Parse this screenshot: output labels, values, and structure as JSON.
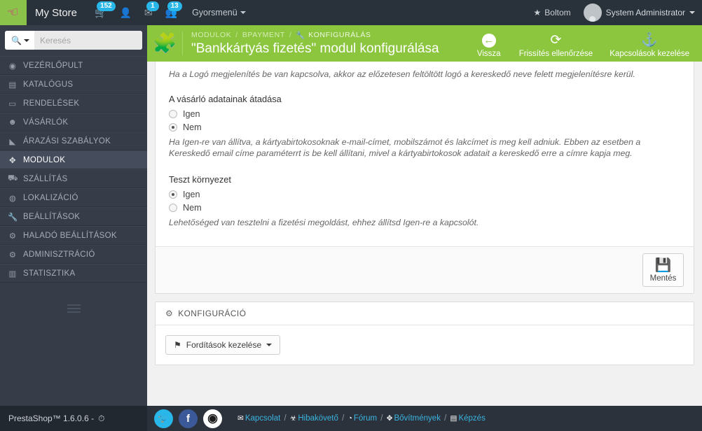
{
  "header": {
    "cursor_icon": "hand-pointer-icon",
    "store_name": "My Store",
    "cart_icon": "cart-icon",
    "cart_badge": "152",
    "customer_icon": "person-icon",
    "mail_icon": "envelope-icon",
    "mail_badge": "1",
    "people_icon": "customers-icon",
    "people_badge": "13",
    "quickmenu_label": "Gyorsmenü",
    "shop_icon": "star-icon",
    "shop_label": "Boltom",
    "avatar_icon": "avatar",
    "user_name": "System Administrator"
  },
  "sidebar": {
    "search_icon": "search-icon",
    "search_placeholder": "Keresés",
    "search_value": "",
    "collapse_icon": "collapse-handle-icon",
    "items": [
      {
        "label": "VEZÉRLŐPULT",
        "icon": "dashboard-icon",
        "glyph": "◉",
        "active": false
      },
      {
        "label": "KATALÓGUS",
        "icon": "catalog-icon",
        "glyph": "▤",
        "active": false
      },
      {
        "label": "RENDELÉSEK",
        "icon": "orders-icon",
        "glyph": "▭",
        "active": false
      },
      {
        "label": "VÁSÁRLÓK",
        "icon": "customers-icon",
        "glyph": "☻",
        "active": false
      },
      {
        "label": "ÁRAZÁSI SZABÁLYOK",
        "icon": "price-rules-icon",
        "glyph": "◣",
        "active": false
      },
      {
        "label": "MODULOK",
        "icon": "modules-icon",
        "glyph": "✥",
        "active": true
      },
      {
        "label": "SZÁLLÍTÁS",
        "icon": "shipping-icon",
        "glyph": "⛟",
        "active": false
      },
      {
        "label": "LOKALIZÁCIÓ",
        "icon": "globe-icon",
        "glyph": "◍",
        "active": false
      },
      {
        "label": "BEÁLLÍTÁSOK",
        "icon": "wrench-icon",
        "glyph": "🔧",
        "active": false
      },
      {
        "label": "HALADÓ BEÁLLÍTÁSOK",
        "icon": "gears-icon",
        "glyph": "⚙",
        "active": false
      },
      {
        "label": "ADMINISZTRÁCIÓ",
        "icon": "gear-icon",
        "glyph": "⚙",
        "active": false
      },
      {
        "label": "STATISZTIKA",
        "icon": "chart-icon",
        "glyph": "▥",
        "active": false
      }
    ],
    "version_icon": "clock-icon",
    "version_label": "PrestaShop™ 1.6.0.6 -"
  },
  "page_head": {
    "module_icon": "puzzle-icon",
    "breadcrumb": {
      "level1": "MODULOK",
      "level2": "BPAYMENT",
      "current_icon": "wrench-icon",
      "current": "KONFIGURÁLÁS",
      "separator": "/"
    },
    "title": "\"Bankkártyás fizetés\" modul konfigurálása",
    "tools": [
      {
        "label": "Vissza",
        "icon": "back-arrow-icon",
        "glyph": "◉"
      },
      {
        "label": "Frissítés ellenőrzése",
        "icon": "refresh-icon",
        "glyph": "⟳"
      },
      {
        "label": "Kapcsolások kezelése",
        "icon": "anchor-icon",
        "glyph": "⚓"
      }
    ]
  },
  "form": {
    "logo_help": "Ha a Logó megjelenítés be van kapcsolva, akkor az előzetesen feltöltött logó a kereskedő neve felett megjelenítésre kerül.",
    "customer_data": {
      "label": "A vásárló adatainak átadása",
      "options": [
        {
          "label": "Igen",
          "checked": false
        },
        {
          "label": "Nem",
          "checked": true
        }
      ],
      "help": "Ha Igen-re van állítva, a kártyabirtokosoknak e-mail-címet, mobilszámot és lakcímet is meg kell adniuk. Ebben az esetben a Kereskedő email címe paraméterrt is be kell állítani, mivel a kártyabirtokosok adatait a kereskedő erre a címre kapja meg."
    },
    "test_env": {
      "label": "Teszt környezet",
      "options": [
        {
          "label": "Igen",
          "checked": true
        },
        {
          "label": "Nem",
          "checked": false
        }
      ],
      "help": "Lehetőséged van tesztelni a fizetési megoldást, ehhez állítsd Igen-re a kapcsolót."
    },
    "save": {
      "label": "Mentés",
      "icon": "floppy-save-icon"
    }
  },
  "config_panel": {
    "icon": "gears-icon",
    "title": "KONFIGURÁCIÓ",
    "translate_button": {
      "icon": "flag-icon",
      "label": "Fordítások kezelése",
      "caret": "chevron-down-icon"
    }
  },
  "footer": {
    "social": [
      {
        "name": "twitter-icon",
        "glyph": "t"
      },
      {
        "name": "facebook-icon",
        "glyph": "f"
      },
      {
        "name": "github-icon",
        "glyph": "◉"
      }
    ],
    "links": [
      {
        "label": "Kapcsolat",
        "icon": "envelope-icon"
      },
      {
        "label": "Hibakövető",
        "icon": "bug-icon"
      },
      {
        "label": "Fórum",
        "icon": "comment-icon"
      },
      {
        "label": "Bővítmények",
        "icon": "puzzle-icon"
      },
      {
        "label": "Képzés",
        "icon": "book-icon"
      }
    ],
    "separator": "/"
  },
  "colors": {
    "brand_green": "#8cc63f",
    "header_dark": "#29313a",
    "sidebar_dark": "#363c48",
    "badge_blue": "#29b6e8",
    "link_blue": "#3ab4e0",
    "cursor_pink": "#e91e8c"
  }
}
